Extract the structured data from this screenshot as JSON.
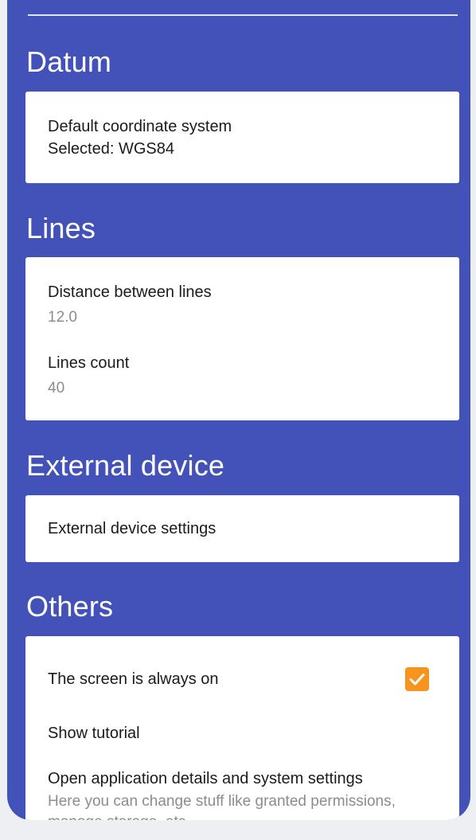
{
  "sections": {
    "datum": {
      "title": "Datum",
      "items": [
        {
          "title": "Default coordinate system",
          "subtitle": "Selected: WGS84"
        }
      ]
    },
    "lines": {
      "title": "Lines",
      "items": [
        {
          "title": "Distance between lines",
          "value": "12.0"
        },
        {
          "title": "Lines count",
          "value": "40"
        }
      ]
    },
    "external_device": {
      "title": "External device",
      "items": [
        {
          "title": "External device settings"
        }
      ]
    },
    "others": {
      "title": "Others",
      "items": [
        {
          "title": "The screen is always on",
          "checked": true
        },
        {
          "title": "Show tutorial"
        },
        {
          "title": "Open application details and system settings",
          "description": "Here you can change stuff like granted permissions, manage storage, etc."
        }
      ]
    }
  },
  "colors": {
    "background": "#4252b8",
    "card": "#ffffff",
    "accent": "#f7941d",
    "primary_text": "#1b1b1b",
    "secondary_text": "#8c8c8c"
  },
  "icons": {
    "checkbox": "check-icon"
  }
}
